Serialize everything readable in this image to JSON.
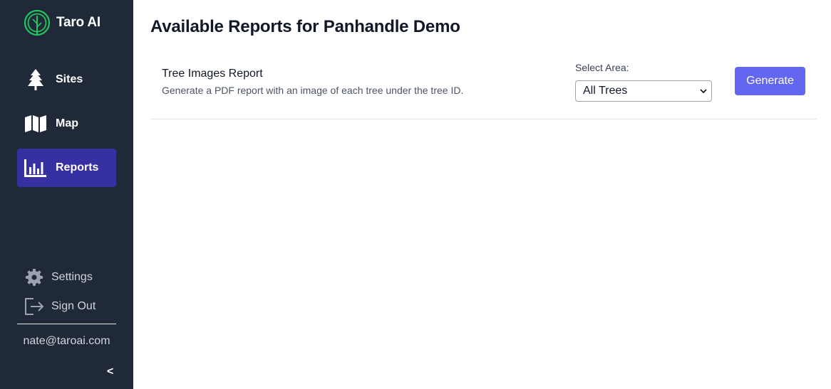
{
  "brand": {
    "name": "Taro AI",
    "logo_icon": "tree-circle-logo-icon",
    "accent": "#22c55e"
  },
  "sidebar": {
    "background": "#1f2937",
    "active_color": "#3730a3",
    "items": [
      {
        "label": "Sites",
        "icon": "tree-icon",
        "active": false
      },
      {
        "label": "Map",
        "icon": "map-icon",
        "active": false
      },
      {
        "label": "Reports",
        "icon": "chart-bar-icon",
        "active": true
      }
    ],
    "bottom": [
      {
        "label": "Settings",
        "icon": "gear-icon"
      },
      {
        "label": "Sign Out",
        "icon": "sign-out-icon"
      }
    ],
    "user_email": "nate@taroai.com",
    "collapse_label": "<"
  },
  "main": {
    "title": "Available Reports for Panhandle Demo",
    "reports": [
      {
        "name": "Tree Images Report",
        "description": "Generate a PDF report with an image of each tree under the tree ID.",
        "area_label": "Select Area:",
        "area_value": "All Trees",
        "button_label": "Generate",
        "button_color": "#6366f1"
      }
    ]
  }
}
